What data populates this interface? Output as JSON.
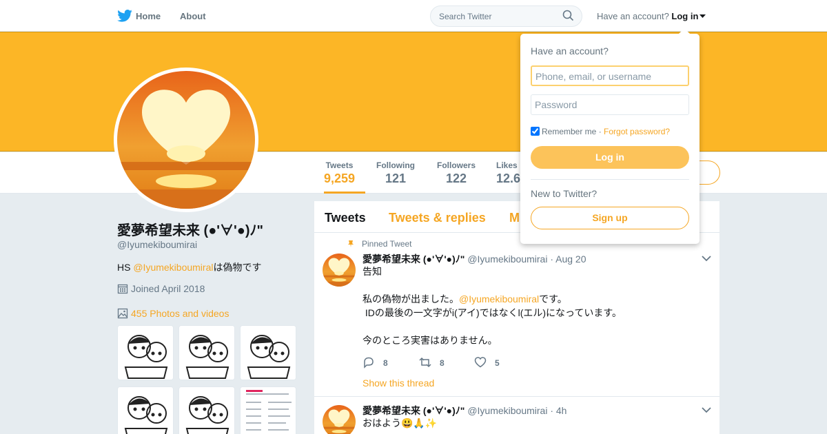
{
  "topbar": {
    "home": "Home",
    "about": "About",
    "search_placeholder": "Search Twitter",
    "have_account": "Have an account?",
    "login": "Log in"
  },
  "profile": {
    "name": "愛夢希望未来 (●'∀'●)ﾉ\"",
    "handle": "@Iyumekiboumirai",
    "bio_prefix": "HS ",
    "bio_link": "@Iyumekiboumiral",
    "bio_suffix": "は偽物です",
    "joined": "Joined April 2018",
    "photos": "455 Photos and videos"
  },
  "stats": [
    {
      "label": "Tweets",
      "value": "9,259"
    },
    {
      "label": "Following",
      "value": "121"
    },
    {
      "label": "Followers",
      "value": "122"
    },
    {
      "label": "Likes",
      "value": "12.6"
    }
  ],
  "tabs": [
    "Tweets",
    "Tweets & replies",
    "M"
  ],
  "tweets": [
    {
      "pinned": "Pinned Tweet",
      "name": "愛夢希望未来 (●'∀'●)ﾉ\"",
      "handle": "@Iyumekiboumirai",
      "date": "· Aug 20",
      "line1": "告知",
      "line2_prefix": "私の偽物が出ました。",
      "line2_link": "@Iyumekiboumiral",
      "line2_suffix": "です。",
      "line3": " IDの最後の一文字がi(アイ)ではなくl(エル)になっています。",
      "line4": "今のところ実害はありません。",
      "replies": "8",
      "retweets": "8",
      "likes": "5",
      "show_thread": "Show this thread"
    },
    {
      "name": "愛夢希望未来 (●'∀'●)ﾉ\"",
      "handle": "@Iyumekiboumirai",
      "date": "· 4h",
      "text": "おはよう😃🙏✨"
    }
  ],
  "login_dropdown": {
    "title": "Have an account?",
    "username_placeholder": "Phone, email, or username",
    "password_placeholder": "Password",
    "remember": "Remember me",
    "separator": " · ",
    "forgot": "Forgot password?",
    "login_button": "Log in",
    "new_to_twitter": "New to Twitter?",
    "signup_button": "Sign up"
  },
  "colors": {
    "accent": "#f5a623",
    "banner": "#fcb626"
  }
}
